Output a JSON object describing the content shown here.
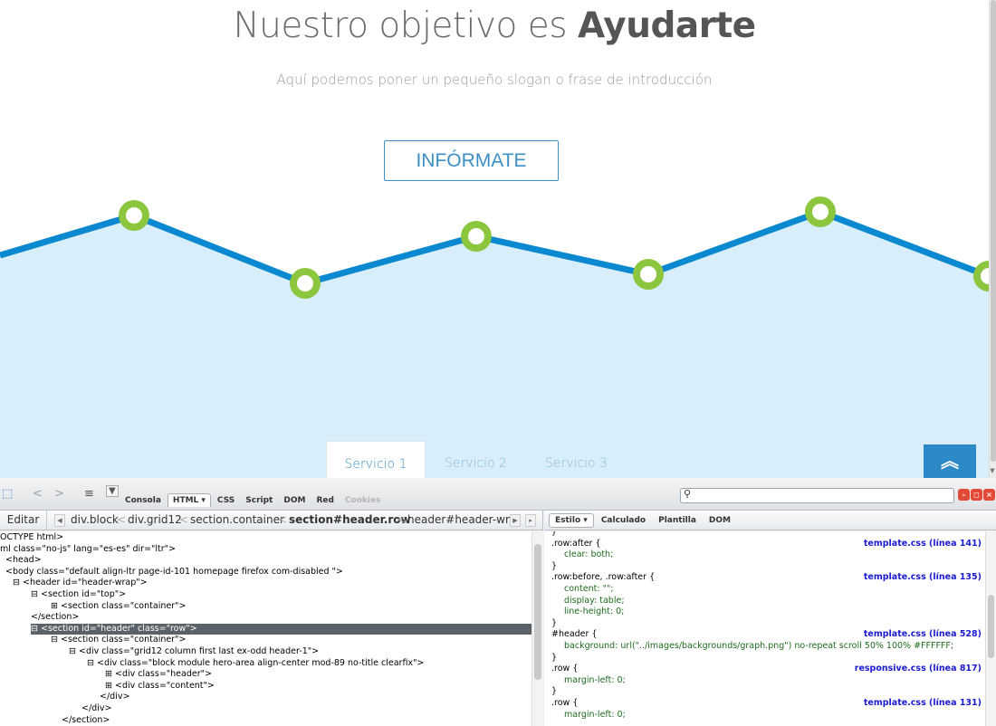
{
  "hero": {
    "title_light": "Nuestro objetivo es ",
    "title_bold": "Ayudarte",
    "slogan": "Aquí podemos poner un pequeño slogan o frase de introducción",
    "cta_label": "INFÓRMATE",
    "graph": {
      "line_color": "#0a88d0",
      "fill_color": "#d9eefb",
      "node_color": "#8cc63f"
    }
  },
  "service_tabs": [
    {
      "label": "Servicio 1"
    },
    {
      "label": "Servicio 2"
    },
    {
      "label": "Servicio 3"
    }
  ],
  "to_top_icon": "double-chevron-up-icon",
  "firebug": {
    "tabs": [
      "Consola",
      "HTML ▾",
      "CSS",
      "Script",
      "DOM",
      "Red",
      "Cookies"
    ],
    "edit_label": "Editar",
    "breadcrumbs": [
      "div.block",
      "div.grid12",
      "section.container",
      "section#header.row",
      "header#header-wrap"
    ],
    "style_tabs": [
      "Estilo ▾",
      "Calculado",
      "Plantilla",
      "DOM"
    ],
    "html_lines": [
      "OCTYPE html>",
      "ml class=\"no-js\" lang=\"es-es\" dir=\"ltr\">",
      "<head>",
      "<body class=\"default align-ltr page-id-101 homepage firefox com-disabled \">",
      "⊟ <header id=\"header-wrap\">",
      "⊟ <section id=\"top\">",
      "⊞ <section class=\"container\">",
      "</section>",
      "⊟ <section id=\"header\" class=\"row\">",
      "⊟ <section class=\"container\">",
      "⊟ <div class=\"grid12 column first last ex-odd header-1\">",
      "⊟ <div class=\"block module hero-area align-center mod-89 no-title clearfix\">",
      "⊞ <div class=\"header\">",
      "⊞ <div class=\"content\">",
      "</div>",
      "</div>",
      "</section>"
    ],
    "css_rules": [
      {
        "selector": "}",
        "source": "",
        "props": []
      },
      {
        "selector": ".row:after {",
        "source": "template.css (línea 141)",
        "props": [
          "clear: both;"
        ]
      },
      {
        "selector": "}",
        "source": "",
        "props": []
      },
      {
        "selector": ".row:before, .row:after {",
        "source": "template.css (línea 135)",
        "props": [
          "content: \"\";",
          "display: table;",
          "line-height: 0;"
        ]
      },
      {
        "selector": "}",
        "source": "",
        "props": []
      },
      {
        "selector": "#header {",
        "source": "template.css (línea 528)",
        "props": [
          "background: url(\"../images/backgrounds/graph.png\") no-repeat scroll 50% 100% #FFFFFF;"
        ]
      },
      {
        "selector": "}",
        "source": "",
        "props": []
      },
      {
        "selector": ".row {",
        "source": "responsive.css (línea 817)",
        "props": [
          "margin-left: 0;"
        ]
      },
      {
        "selector": "}",
        "source": "",
        "props": []
      },
      {
        "selector": ".row {",
        "source": "template.css (línea 131)",
        "props": [
          "margin-left: 0;"
        ]
      }
    ]
  }
}
